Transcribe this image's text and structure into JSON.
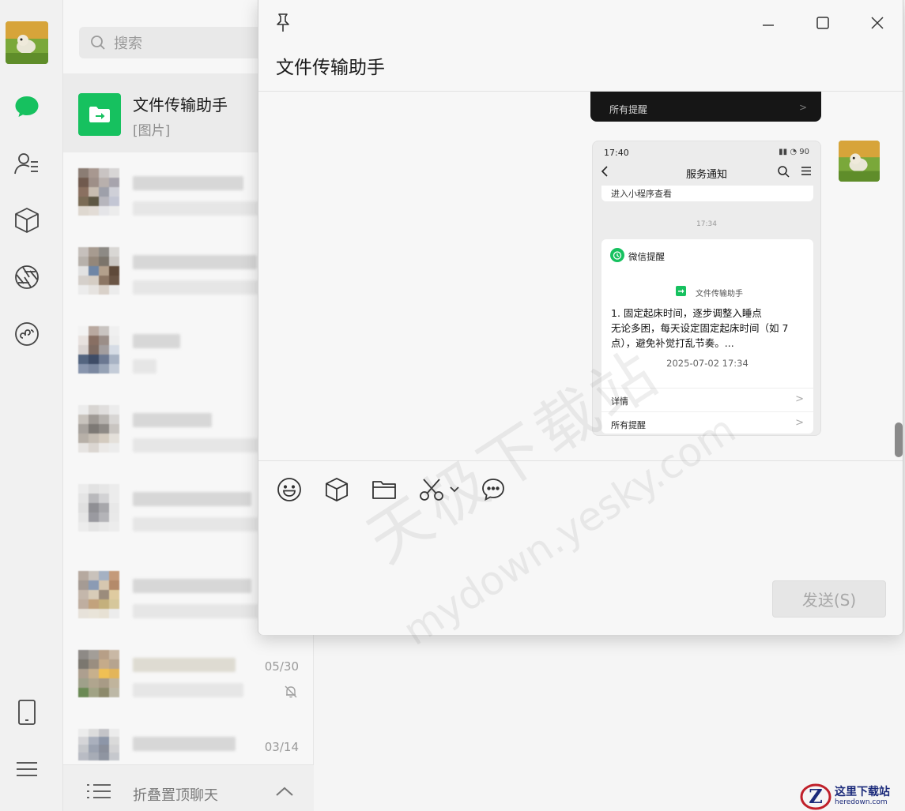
{
  "search": {
    "placeholder": "搜索"
  },
  "active_chat": {
    "name": "文件传输助手",
    "preview": "[图片]"
  },
  "chat_dates": [
    "05/30",
    "03/14"
  ],
  "folded_label": "折叠置顶聊天",
  "window": {
    "title": "文件传输助手"
  },
  "shot_top": {
    "row_label": "所有提醒",
    "chevron": ">"
  },
  "shot": {
    "status_time": "17:40",
    "status_right": "▮▮ ◔ 90",
    "nav_title": "服务通知",
    "card_a_text": "进入小程序查看",
    "timestamp": "17:34",
    "card_source": "微信提醒",
    "card_tag": "文件传输助手",
    "lines": [
      "1. 固定起床时间，逐步调整入睡点",
      "无论多困，每天设定固定起床时间（如 7",
      "点），避免补觉打乱节奏。..."
    ],
    "card_date": "2025-07-02 17:34",
    "row_detail": "详情",
    "row_all": "所有提醒",
    "chevron": ">"
  },
  "send_label": "发送(S)",
  "watermark": {
    "main": "天极下载站",
    "sub": "mydown.yesky.com"
  },
  "corner_logo": {
    "title": "这里下载站",
    "domain": "heredown.com"
  },
  "colors": {
    "wechat_green": "#16c15f",
    "rail_bg": "#f1f1f1",
    "list_bg": "#f7f7f7"
  }
}
